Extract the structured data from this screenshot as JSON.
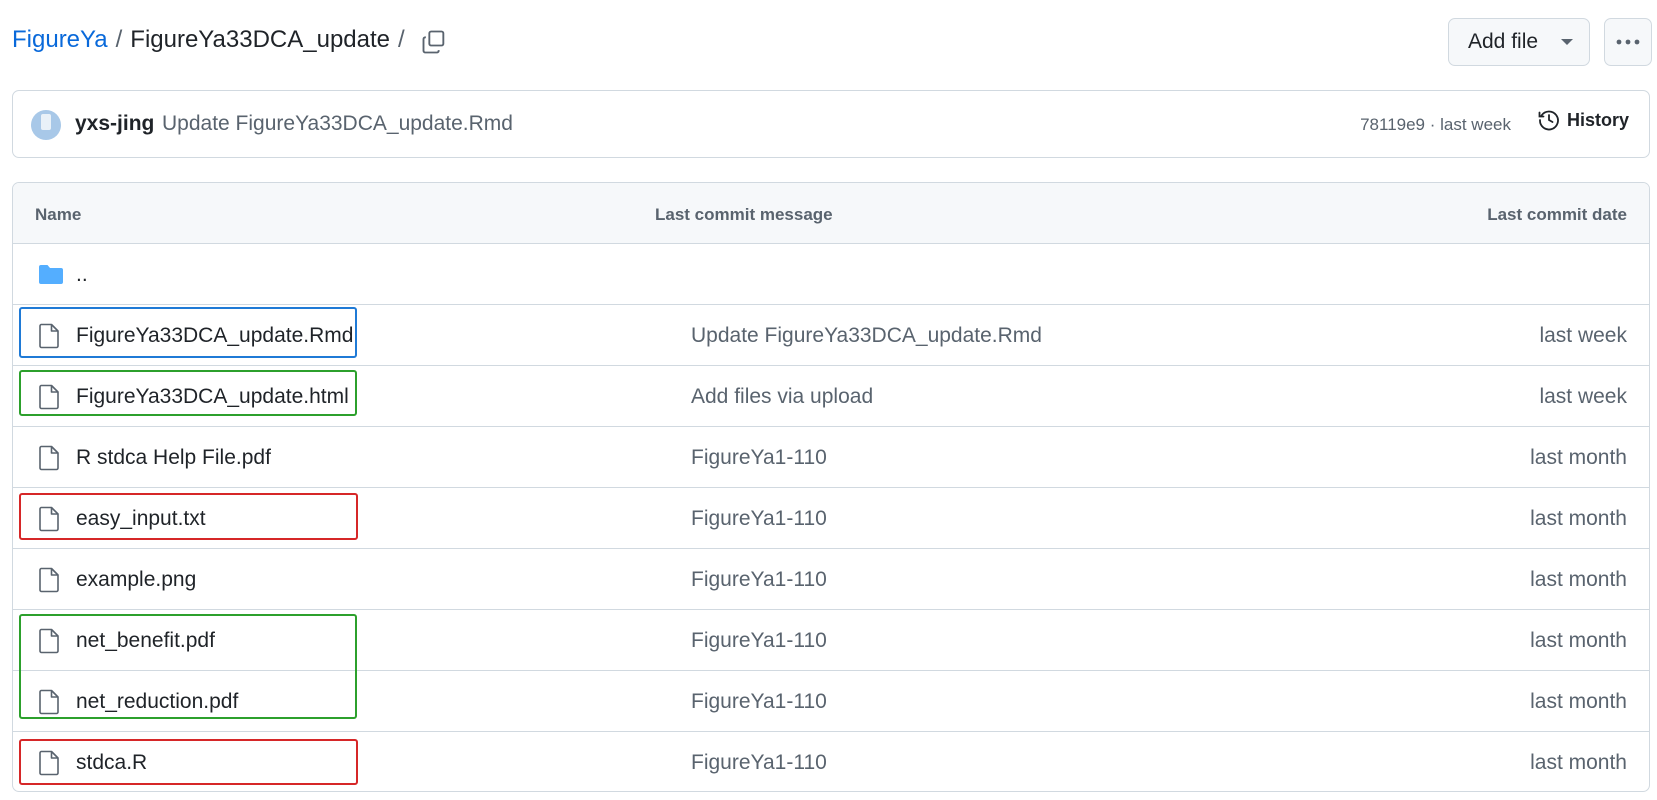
{
  "breadcrumb": {
    "repo": "FigureYa",
    "separator": "/",
    "directory": "FigureYa33DCA_update",
    "trailing": "/"
  },
  "header": {
    "add_file_label": "Add file"
  },
  "latest_commit": {
    "author": "yxs-jing",
    "message": "Update FigureYa33DCA_update.Rmd",
    "sha_time": "78119e9 · last week",
    "history_label": "History"
  },
  "table": {
    "headers": {
      "name": "Name",
      "message": "Last commit message",
      "date": "Last commit date"
    },
    "parent": "..",
    "rows": [
      {
        "name": "FigureYa33DCA_update.Rmd",
        "message": "Update FigureYa33DCA_update.Rmd",
        "date": "last week"
      },
      {
        "name": "FigureYa33DCA_update.html",
        "message": "Add files via upload",
        "date": "last week"
      },
      {
        "name": "R stdca Help File.pdf",
        "message": "FigureYa1-110",
        "date": "last month"
      },
      {
        "name": "easy_input.txt",
        "message": "FigureYa1-110",
        "date": "last month"
      },
      {
        "name": "example.png",
        "message": "FigureYa1-110",
        "date": "last month"
      },
      {
        "name": "net_benefit.pdf",
        "message": "FigureYa1-110",
        "date": "last month"
      },
      {
        "name": "net_reduction.pdf",
        "message": "FigureYa1-110",
        "date": "last month"
      },
      {
        "name": "stdca.R",
        "message": "FigureYa1-110",
        "date": "last month"
      }
    ]
  },
  "highlight_colors": {
    "blue": "#1f7ad6",
    "green": "#2ca02c",
    "red": "#d62728"
  },
  "icons": {
    "file": "file-icon",
    "folder": "folder-icon",
    "copy": "copy-icon",
    "history": "history-icon",
    "more": "kebab-horizontal-icon"
  }
}
